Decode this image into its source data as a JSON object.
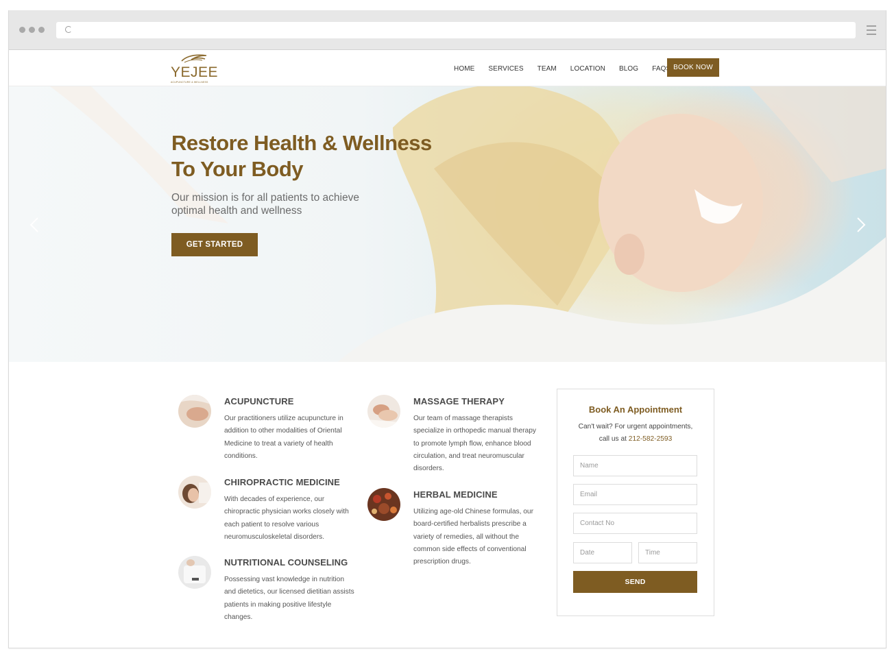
{
  "browser": {
    "window_dots": 3
  },
  "header": {
    "logo_text": "YEJEE",
    "logo_sub": "ACUPUNCTURE & WELLNESS",
    "nav": [
      {
        "label": "HOME"
      },
      {
        "label": "SERVICES"
      },
      {
        "label": "TEAM"
      },
      {
        "label": "LOCATION"
      },
      {
        "label": "BLOG"
      },
      {
        "label": "FAQS"
      }
    ],
    "cta": "BOOK NOW"
  },
  "hero": {
    "title_line1": "Restore Health & Wellness",
    "title_line2": "To Your Body",
    "subtitle_line1": "Our mission is for all patients to achieve",
    "subtitle_line2": "optimal health and wellness",
    "cta": "GET STARTED"
  },
  "services": [
    {
      "title": "ACUPUNCTURE",
      "description": "Our practitioners utilize acupuncture in addition to other modalities of Oriental Medicine to treat a variety of health conditions."
    },
    {
      "title": "CHIROPRACTIC MEDICINE",
      "description": "With decades of experience, our chiropractic physician works closely with each patient to resolve various neuromusculoskeletal disorders."
    },
    {
      "title": "NUTRITIONAL COUNSELING",
      "description": "Possessing vast knowledge in nutrition and dietetics, our licensed dietitian assists patients in making positive lifestyle changes."
    },
    {
      "title": "MASSAGE THERAPY",
      "description": "Our team of massage therapists specialize in orthopedic manual therapy to promote lymph flow, enhance blood circulation, and treat neuromuscular disorders."
    },
    {
      "title": "HERBAL MEDICINE",
      "description": "Utilizing age-old Chinese formulas, our board-certified herbalists prescribe a variety of remedies, all without the common side effects of conventional prescription drugs."
    }
  ],
  "booking": {
    "title": "Book An Appointment",
    "note_line1": "Can't wait? For urgent appointments,",
    "note_prefix": "call us at",
    "phone": "212-582-2593",
    "fields": {
      "name": "Name",
      "email": "Email",
      "contact": "Contact No",
      "date": "Date",
      "time": "Time"
    },
    "submit": "SEND"
  },
  "colors": {
    "brand": "#7e5c22",
    "text": "#4a4a4a"
  }
}
